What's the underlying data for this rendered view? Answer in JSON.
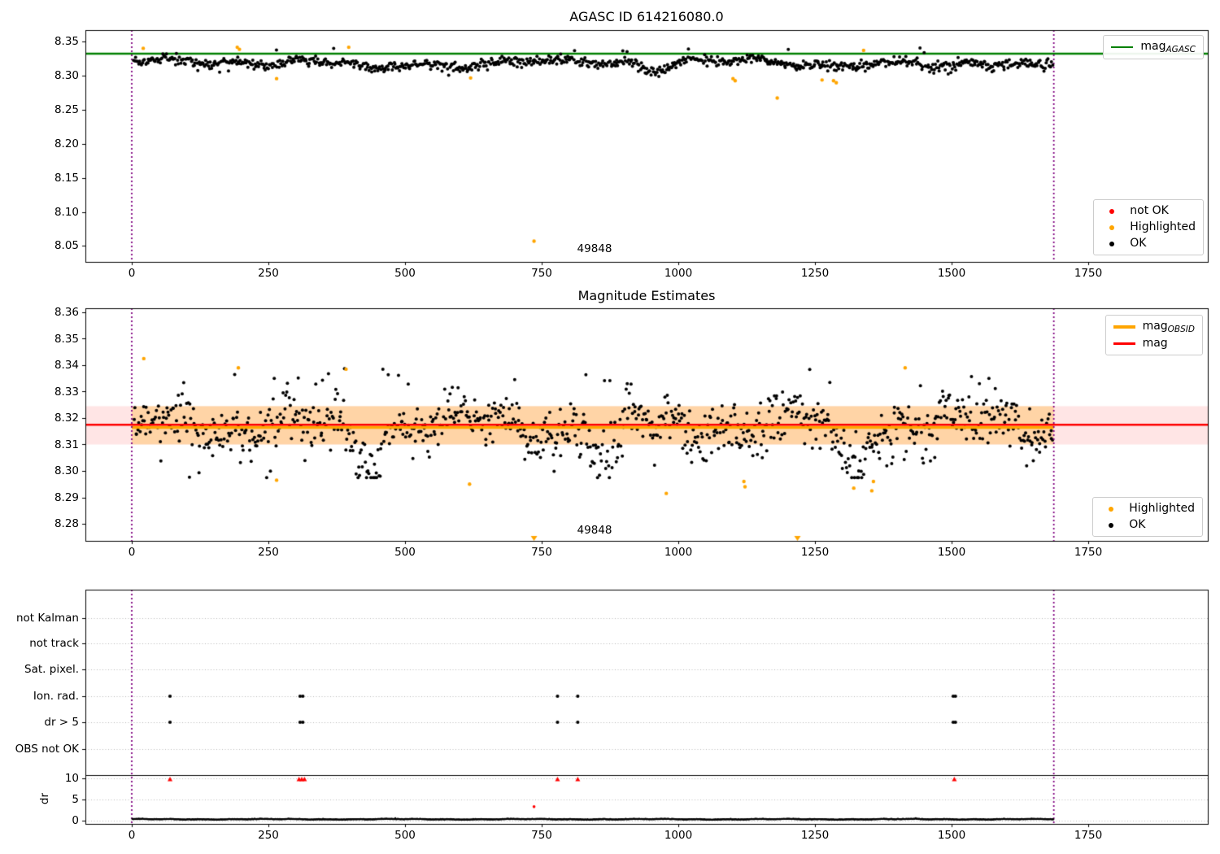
{
  "colors": {
    "mag_agasc_green": "#008000",
    "mag_red": "#ff0000",
    "obsid_orange": "#ffa500",
    "boundary_purple": "#800080",
    "ok_black": "#000000",
    "band_pink": "rgba(255,0,0,0.10)",
    "band_orange": "rgba(255,165,0,0.28)",
    "grid_gray": "#b8b8b8"
  },
  "chart_data": [
    {
      "type": "scatter",
      "title": "AGASC ID 614216080.0",
      "xlim": [
        -85,
        1969
      ],
      "ylim": [
        8.0265,
        8.3667
      ],
      "xticks": [
        "0",
        "250",
        "500",
        "750",
        "1000",
        "1250",
        "1500",
        "1750"
      ],
      "xtick_values": [
        0,
        250,
        500,
        750,
        1000,
        1250,
        1500,
        1750
      ],
      "yticks": [
        "8.05",
        "8.10",
        "8.15",
        "8.20",
        "8.25",
        "8.30",
        "8.35"
      ],
      "ytick_values": [
        8.05,
        8.1,
        8.15,
        8.2,
        8.25,
        8.3,
        8.35
      ],
      "mag_agasc_line": {
        "value": 8.332,
        "color": "#008000",
        "legend_main": "mag",
        "legend_sub": "AGASC"
      },
      "obsid_boundaries": {
        "x": [
          0,
          1687
        ],
        "color": "#800080",
        "style": "dotted"
      },
      "annotation": {
        "text": "49848",
        "x": 847,
        "y": 8.045
      },
      "ok_points": {
        "n": 950,
        "x_range": [
          4,
          1685
        ],
        "center": 8.3195,
        "spread": 0.007,
        "y_min": 8.2965,
        "y_max": 8.345,
        "seed": 1337
      },
      "highlighted_points": [
        [
          21,
          8.34
        ],
        [
          193,
          8.3415
        ],
        [
          197,
          8.3385
        ],
        [
          265,
          8.2955
        ],
        [
          397,
          8.3415
        ],
        [
          620,
          8.2965
        ],
        [
          736,
          8.057
        ],
        [
          1100,
          8.2955
        ],
        [
          1104,
          8.2925
        ],
        [
          1181,
          8.267
        ],
        [
          1263,
          8.2935
        ],
        [
          1284,
          8.2925
        ],
        [
          1289,
          8.2895
        ],
        [
          1339,
          8.337
        ]
      ],
      "legend_markers": [
        {
          "label": "not OK",
          "color": "#ff0000"
        },
        {
          "label": "Highlighted",
          "color": "#ffa500"
        },
        {
          "label": "OK",
          "color": "#000000"
        }
      ]
    },
    {
      "type": "scatter",
      "title": "Magnitude Estimates",
      "xlim": [
        -85,
        1969
      ],
      "ylim": [
        8.2736,
        8.3615
      ],
      "xticks": [
        "0",
        "250",
        "500",
        "750",
        "1000",
        "1250",
        "1500",
        "1750"
      ],
      "xtick_values": [
        0,
        250,
        500,
        750,
        1000,
        1250,
        1500,
        1750
      ],
      "yticks": [
        "8.28",
        "8.29",
        "8.30",
        "8.31",
        "8.32",
        "8.33",
        "8.34",
        "8.35",
        "8.36"
      ],
      "ytick_values": [
        8.28,
        8.29,
        8.3,
        8.31,
        8.32,
        8.33,
        8.34,
        8.35,
        8.36
      ],
      "mag_line": {
        "value": 8.3175,
        "color": "#ff0000"
      },
      "mag_obsid_line": {
        "value": 8.3165,
        "color": "#ffa500",
        "x_range": [
          0,
          1687
        ]
      },
      "uncertainty_band": {
        "lo": 8.31,
        "hi": 8.3245
      },
      "obsid_boundaries": {
        "x": [
          0,
          1687
        ],
        "color": "#800080",
        "style": "dotted"
      },
      "annotation": {
        "text": "49848",
        "x": 847,
        "y": 8.2775
      },
      "ok_points": {
        "n": 950,
        "x_range": [
          4,
          1685
        ],
        "center": 8.3175,
        "spread": 0.009,
        "y_min": 8.2975,
        "y_max": 8.3415,
        "seed": 2024
      },
      "highlighted_points": [
        [
          22,
          8.3425
        ],
        [
          195,
          8.339
        ],
        [
          265,
          8.2965
        ],
        [
          392,
          8.3385
        ],
        [
          618,
          8.295
        ],
        [
          978,
          8.2915
        ],
        [
          1120,
          8.296
        ],
        [
          1122,
          8.294
        ],
        [
          1321,
          8.2935
        ],
        [
          1354,
          8.2925
        ],
        [
          1357,
          8.296
        ],
        [
          1415,
          8.339
        ]
      ],
      "below_range_triangles_x": [
        736,
        1218
      ],
      "line_legend_rows": [
        {
          "main": "mag",
          "sub": "OBSID",
          "color": "#ffa500",
          "thickness": 3.5
        },
        {
          "main": "mag",
          "sub": "",
          "color": "#ff0000",
          "thickness": 2.5
        }
      ],
      "legend_markers": [
        {
          "label": "Highlighted",
          "color": "#ffa500"
        },
        {
          "label": "OK",
          "color": "#000000"
        }
      ]
    },
    {
      "type": "flags",
      "categories": [
        "not Kalman",
        "not track",
        "Sat. pixel.",
        "Ion. rad.",
        "dr > 5",
        "OBS not OK"
      ],
      "flag_points": {
        "ion_rad_x": [
          70,
          308,
          313,
          779,
          816,
          1503,
          1507
        ],
        "dr_gt_5_x": [
          70,
          308,
          313,
          779,
          816,
          1503,
          1507
        ]
      },
      "dr_clipped_points": {
        "x": [
          70,
          306,
          311,
          316,
          779,
          816,
          1505
        ],
        "value": 9.8,
        "color": "#ff0000"
      },
      "dr_outlier_points": [
        [
          736,
          3.3
        ]
      ],
      "dr_axis": {
        "label": "dr",
        "ticks": [
          "10",
          "5",
          "0"
        ],
        "tick_values": [
          10,
          5,
          0
        ],
        "separator_dr": 10.75
      },
      "dr_trace": {
        "n": 1300,
        "x_range": [
          1,
          1686
        ],
        "typical": 0.35,
        "seed": 777
      },
      "xticks": [
        "0",
        "250",
        "500",
        "750",
        "1000",
        "1250",
        "1500",
        "1750"
      ],
      "xtick_values": [
        0,
        250,
        500,
        750,
        1000,
        1250,
        1500,
        1750
      ],
      "obsid_boundaries": {
        "x": [
          0,
          1687
        ],
        "color": "#800080",
        "style": "dotted"
      },
      "grid": "dotted"
    }
  ]
}
